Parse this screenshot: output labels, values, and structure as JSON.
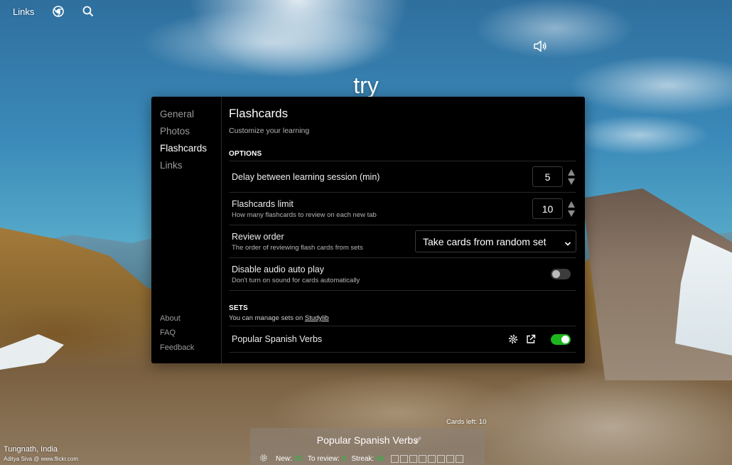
{
  "topbar": {
    "links_label": "Links"
  },
  "word": "try",
  "modal": {
    "nav": [
      {
        "label": "General",
        "active": false
      },
      {
        "label": "Photos",
        "active": false
      },
      {
        "label": "Flashcards",
        "active": true
      },
      {
        "label": "Links",
        "active": false
      }
    ],
    "footer_links": [
      "About",
      "FAQ",
      "Feedback"
    ],
    "title": "Flashcards",
    "subtitle": "Customize your learning",
    "options_heading": "OPTIONS",
    "options": {
      "delay": {
        "label": "Delay between learning session (min)",
        "value": "5"
      },
      "limit": {
        "label": "Flashcards limit",
        "hint": "How many flashcards to review on each new tab",
        "value": "10"
      },
      "order": {
        "label": "Review order",
        "hint": "The order of reviewing flash cards from sets",
        "selected": "Take cards from random set"
      },
      "audio": {
        "label": "Disable audio auto play",
        "hint": "Don't turn on sound for cards automatically",
        "enabled": false
      }
    },
    "sets_heading": "SETS",
    "sets_note_prefix": "You can manage sets on ",
    "sets_note_link": "Studylib",
    "sets": [
      {
        "name": "Popular Spanish Verbs",
        "enabled": true
      }
    ]
  },
  "photo": {
    "place": "Tungnath, India",
    "author": "Aditya Siva @ www.flickr.com"
  },
  "deck": {
    "cards_left": "Cards left: 10",
    "name": "Popular Spanish Verbs",
    "new_label": "New:",
    "new_value": "20",
    "review_label": "To review:",
    "review_value": "0",
    "streak_label": "Streak:",
    "streak_value": "0d"
  },
  "colors": {
    "accent_green": "#1db61d",
    "panel_bg": "#000000"
  },
  "icons": [
    "chrome-icon",
    "search-icon",
    "speaker-icon",
    "gear-icon",
    "external-link-icon",
    "chevron-down-icon",
    "spinner-arrows-icon"
  ]
}
